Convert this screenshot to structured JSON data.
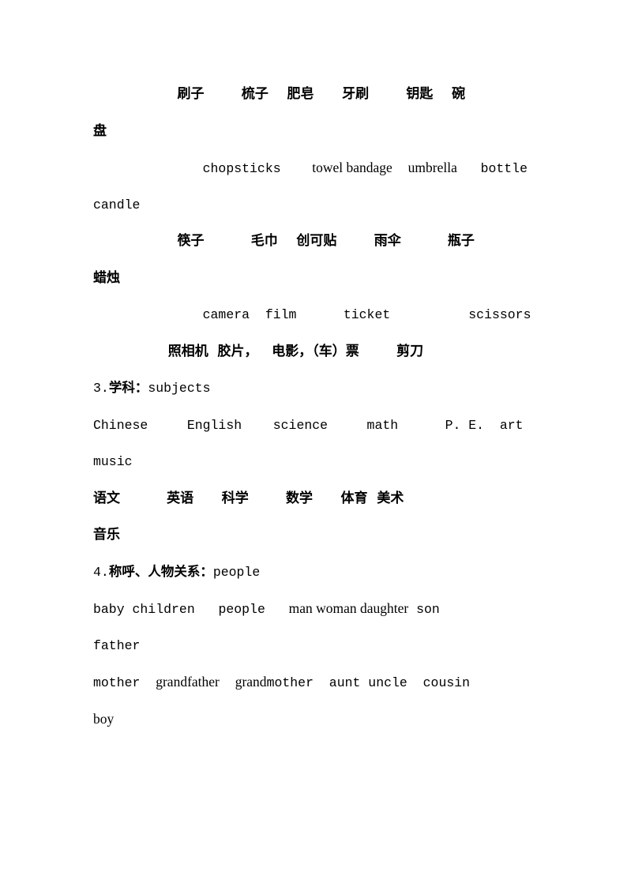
{
  "document": {
    "type": "vocabulary-study-sheet",
    "language": "zh-CN/en",
    "text_color": "#000000",
    "background_color": "#ffffff"
  },
  "lines": {
    "l1": {
      "seg1": "                  刷子        梳子    肥皂      牙刷        钥匙    碗"
    },
    "l2": {
      "seg1": "盘"
    },
    "l3": {
      "seg1": "              ",
      "seg2": "chopsticks",
      "seg3": "    ",
      "seg4": "towel bandage",
      "seg5": "  ",
      "seg6": "umbrella",
      "seg7": "   ",
      "seg8": "bottle"
    },
    "l4": {
      "seg1": "candle"
    },
    "l5": {
      "seg1": "                  筷子          毛巾    创可贴        雨伞          瓶子"
    },
    "l6": {
      "seg1": "蜡烛"
    },
    "l7": {
      "seg1": "              camera  film      ticket          scissors"
    },
    "l8": {
      "seg1": "                照相机  胶片，   电影，（车）票        剪刀"
    },
    "l9": {
      "seg1": "3.",
      "seg2": "学科：",
      "seg3": "subjects"
    },
    "l10": {
      "seg1": "Chinese     English    science     math      P. E.  art"
    },
    "l11": {
      "seg1": "music"
    },
    "l12": {
      "seg1": "语文          英语      科学        数学      体育  美术"
    },
    "l13": {
      "seg1": "音乐"
    },
    "l14": {
      "seg1": "4.",
      "seg2": "称呼、人物关系：",
      "seg3": "people"
    },
    "l15": {
      "seg1": "baby children",
      "seg2": "   ",
      "seg3": "people",
      "seg4": "   ",
      "seg5": "man woman daughter",
      "seg6": " ",
      "seg7": "son"
    },
    "l16": {
      "seg1": "father"
    },
    "l17": {
      "seg1": "mother",
      "seg2": "  ",
      "seg3": "grandfather",
      "seg4": "  ",
      "seg5": "grand",
      "seg6": "mother",
      "seg7": "  ",
      "seg8": "aunt uncle",
      "seg9": "  ",
      "seg10": "cousin"
    },
    "l18": {
      "seg1": "boy"
    }
  }
}
